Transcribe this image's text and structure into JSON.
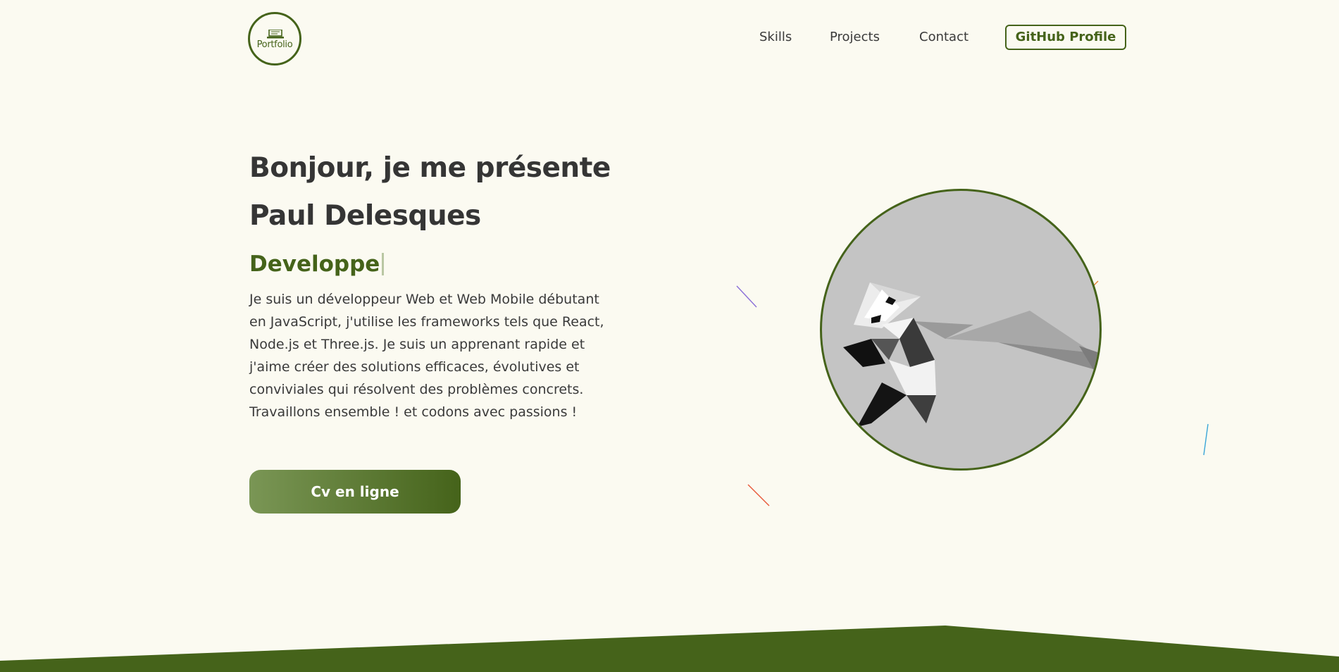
{
  "header": {
    "logo_text": "Portfolio",
    "nav": [
      {
        "label": "Skills"
      },
      {
        "label": "Projects"
      },
      {
        "label": "Contact"
      }
    ],
    "github_label": "GitHub Profile"
  },
  "hero": {
    "greeting": "Bonjour, je me présente",
    "name": "Paul Delesques",
    "role": "Developpe",
    "bio_lines": [
      "Je suis un développeur Web et Web Mobile débutant",
      "en JavaScript, j'utilise les frameworks tels que React,",
      "Node.js et Three.js. Je suis un apprenant rapide et",
      "j'aime créer des solutions efficaces, évolutives et",
      "conviviales qui résolvent des problèmes concrets.",
      "Travaillons ensemble ! et codons avec passions !"
    ],
    "cv_label": "Cv en ligne"
  },
  "colors": {
    "accent": "#45631a",
    "background": "#fbfaf1",
    "text": "#353535",
    "avatar_bg": "#c4c4c4"
  },
  "icons": {
    "logo": "laptop-icon",
    "illustration": "origami-panda-illustration"
  }
}
